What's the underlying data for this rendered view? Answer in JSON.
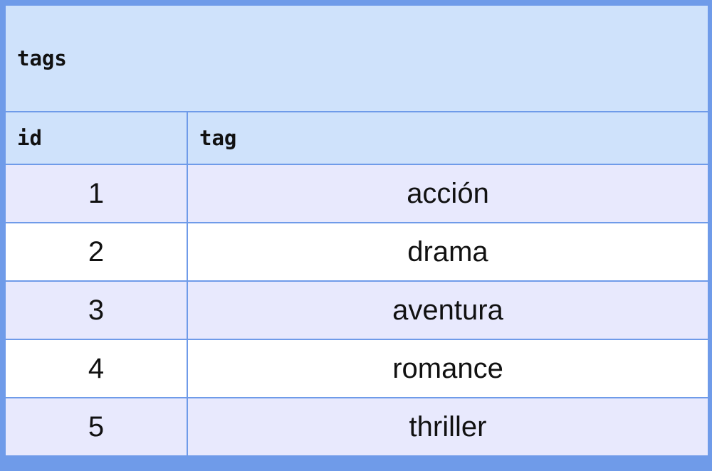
{
  "table": {
    "name": "tags",
    "columns": [
      "id",
      "tag"
    ],
    "rows": [
      {
        "id": "1",
        "tag": "acción"
      },
      {
        "id": "2",
        "tag": "drama"
      },
      {
        "id": "3",
        "tag": "aventura"
      },
      {
        "id": "4",
        "tag": "romance"
      },
      {
        "id": "5",
        "tag": "thriller"
      }
    ]
  },
  "colors": {
    "border": "#6f9be9",
    "header_background": "#cfe2fb",
    "row_shaded": "#e8e9fd",
    "row_plain": "#ffffff"
  }
}
